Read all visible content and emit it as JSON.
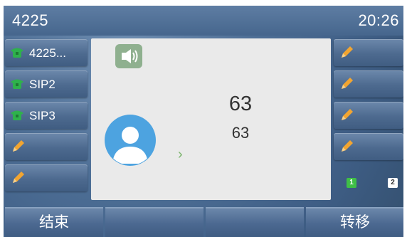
{
  "status_bar": {
    "account": "4225",
    "time": "20:26"
  },
  "left_line_keys": [
    {
      "label": "4225...",
      "icon": "phone-icon"
    },
    {
      "label": "SIP2",
      "icon": "phone-icon"
    },
    {
      "label": "SIP3",
      "icon": "phone-icon"
    },
    {
      "label": "",
      "icon": "pencil-icon"
    },
    {
      "label": "",
      "icon": "pencil-icon"
    }
  ],
  "right_line_keys": [
    {
      "label": "",
      "icon": "pencil-icon"
    },
    {
      "label": "",
      "icon": "pencil-icon"
    },
    {
      "label": "",
      "icon": "pencil-icon"
    },
    {
      "label": "",
      "icon": "pencil-icon"
    }
  ],
  "call": {
    "caller_name": "63",
    "caller_number": "63",
    "audio_mode_icon": "speaker-icon",
    "avatar_icon": "avatar-icon"
  },
  "page_indicator": {
    "pages": [
      "1",
      "2"
    ],
    "current": "1"
  },
  "softkeys": [
    {
      "label": "结束"
    },
    {
      "label": ""
    },
    {
      "label": ""
    },
    {
      "label": "转移"
    }
  ],
  "colors": {
    "background": "#4d6e95",
    "panel": "#eaeaea",
    "phone_green": "#2fb14c",
    "pencil_orange": "#f2a531",
    "speaker_badge": "#8fb08f",
    "avatar_blue": "#4da3e0"
  }
}
